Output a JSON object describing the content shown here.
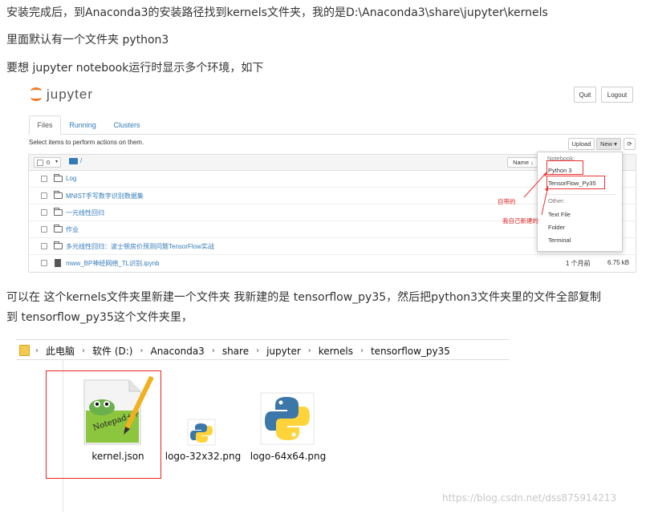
{
  "paragraphs": {
    "p1": "安装完成后，到Anaconda3的安装路径找到kernels文件夹，我的是D:\\Anaconda3\\share\\jupyter\\kernels",
    "p2": "里面默认有一个文件夹 python3",
    "p3": "要想 jupyter notebook运行时显示多个环境，如下",
    "p4": "可以在 这个kernels文件夹里新建一个文件夹 我新建的是 tensorflow_py35，然后把python3文件夹里的文件全部复制",
    "p5": "到 tensorflow_py35这个文件夹里，"
  },
  "jupyter": {
    "logo_text": "jupyter",
    "quit_label": "Quit",
    "logout_label": "Logout",
    "tabs": [
      "Files",
      "Running",
      "Clusters"
    ],
    "select_text": "Select items to perform actions on them.",
    "upload_label": "Upload",
    "new_label": "New ▾",
    "refresh_symbol": "⟳",
    "count": "0",
    "path": "/",
    "name_sort": "Name ↓",
    "rows": [
      {
        "name": "Log",
        "type": "folder",
        "modified": "",
        "size": ""
      },
      {
        "name": "MNIST手写数字识别数据集",
        "type": "folder",
        "modified": "",
        "size": ""
      },
      {
        "name": "一元线性回归",
        "type": "folder",
        "modified": "",
        "size": ""
      },
      {
        "name": "作业",
        "type": "folder",
        "modified": "",
        "size": ""
      },
      {
        "name": "多元线性回归：波士顿房价预测问题TensorFlow实战",
        "type": "folder",
        "modified": "",
        "size": ""
      },
      {
        "name": "mww_BP神经网络_TL识别.ipynb",
        "type": "notebook",
        "modified": "1 个月前",
        "size": "6.75 kB"
      }
    ],
    "dropdown": {
      "notebook_header": "Notebook:",
      "python3": "Python 3",
      "tf": "TensorFlow_Py35",
      "other_header": "Other:",
      "text_file": "Text File",
      "folder": "Folder",
      "terminal": "Terminal"
    },
    "annot_builtin": "自带的",
    "annot_mine": "我自己新建的",
    "accent": "#f37726"
  },
  "explorer": {
    "crumbs": [
      "此电脑",
      "软件 (D:)",
      "Anaconda3",
      "share",
      "jupyter",
      "kernels",
      "tensorflow_py35"
    ],
    "files": [
      "kernel.json",
      "logo-32x32.png",
      "logo-64x64.png"
    ]
  },
  "watermark": "https://blog.csdn.net/dss875914213"
}
